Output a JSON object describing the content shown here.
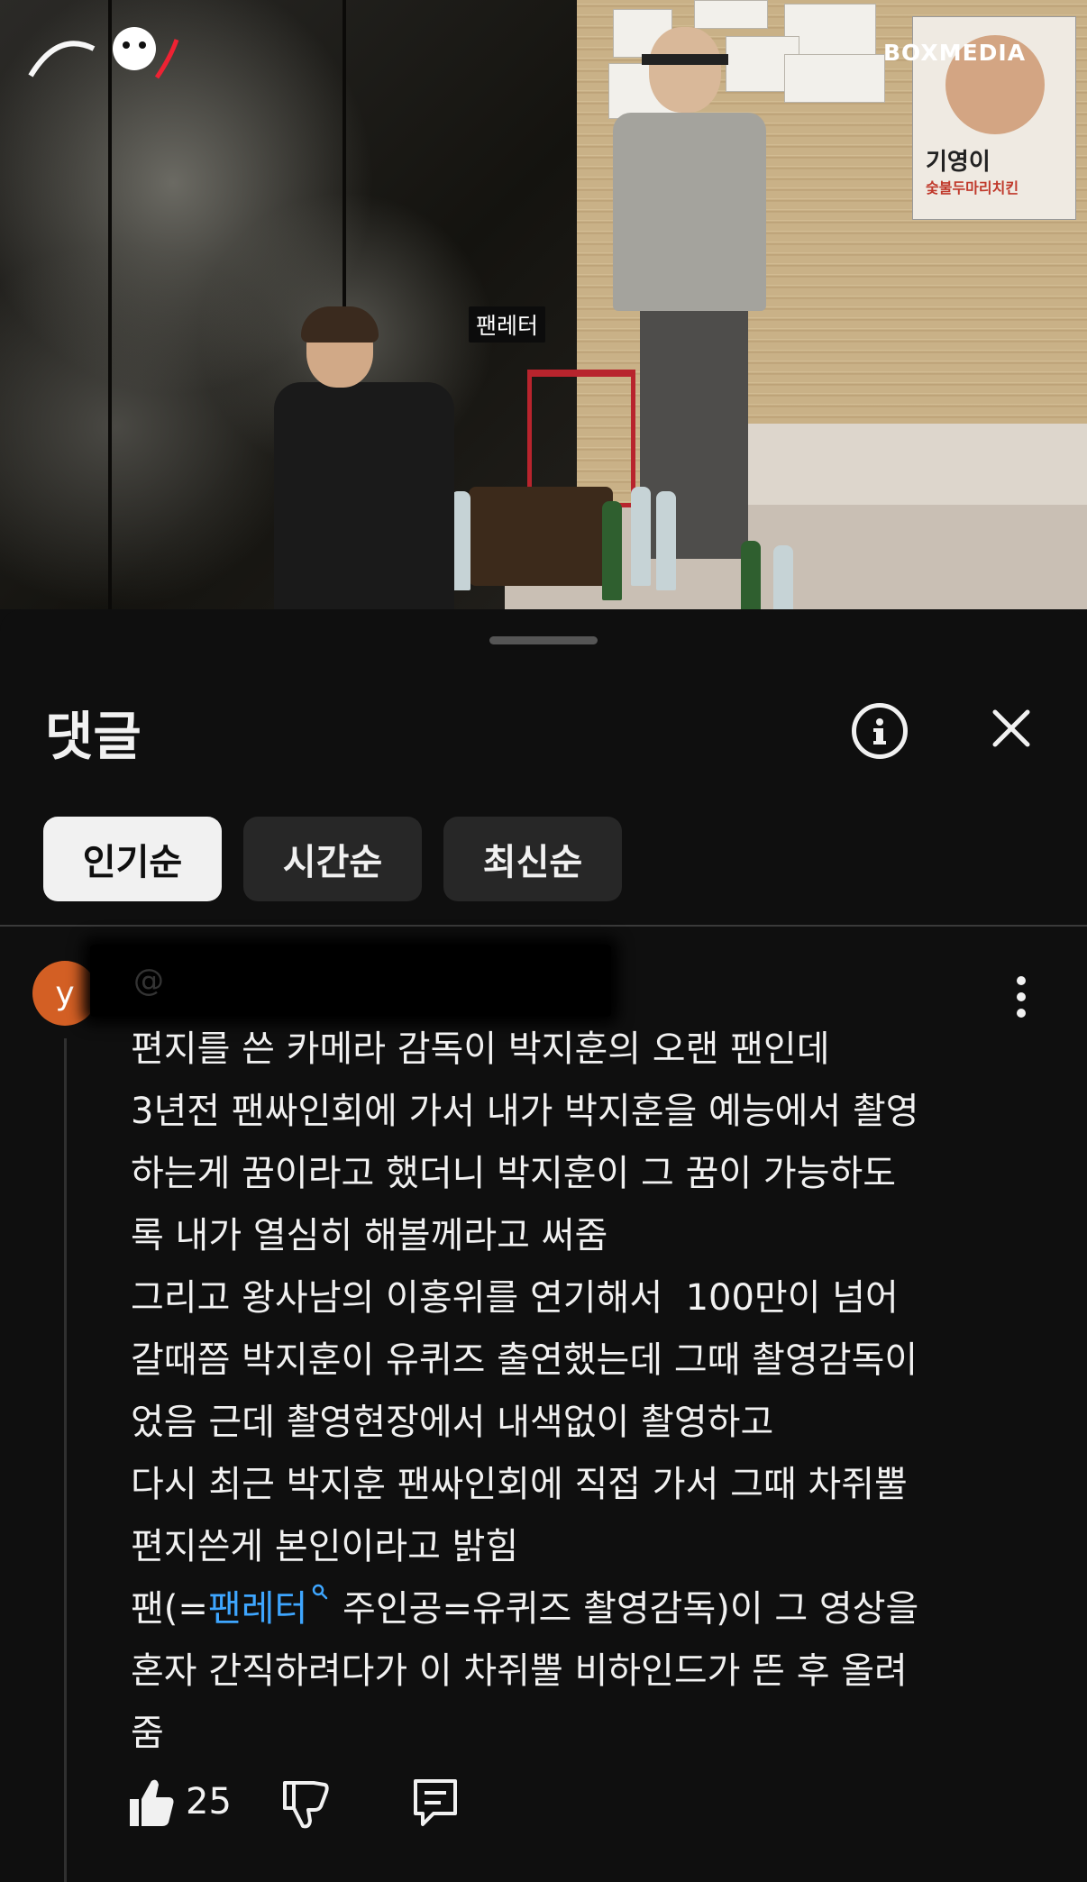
{
  "video": {
    "channel_logo": "BOXMEDIA",
    "caption_tag": "팬레터",
    "poster_title": "기영이",
    "poster_subtitle": "숯불두마리치킨"
  },
  "sheet": {
    "title": "댓글",
    "icons": {
      "info": "info-icon",
      "close": "close-icon"
    }
  },
  "sort_chips": [
    {
      "label": "인기순",
      "active": true
    },
    {
      "label": "시간순",
      "active": false
    },
    {
      "label": "최신순",
      "active": false
    }
  ],
  "comment": {
    "avatar_letter": "y",
    "author_prefix": "@",
    "text_before_link": "편지를 쓴 카메라 감독이 박지훈의 오랜 팬인데\n3년전 팬싸인회에 가서 내가 박지훈을 예능에서 촬영\n하는게 꿈이라고 했더니 박지훈이 그 꿈이 가능하도\n록 내가 열심히 해볼께라고 써줌\n그리고 왕사남의 이홍위를 연기해서  100만이 넘어\n갈때쯤 박지훈이 유퀴즈 출연했는데 그때 촬영감독이\n었음 근데 촬영현장에서 내색없이 촬영하고\n다시 최근 박지훈 팬싸인회에 직접 가서 그때 차쥐뿔\n편지쓴게 본인이라고 밝힘\n팬(=",
    "link_text": "팬레터",
    "text_after_link": " 주인공=유퀴즈 촬영감독)이 그 영상을\n혼자 간직하려다가 이 차쥐뿔 비하인드가 뜬 후 올려\n줌",
    "like_count": "25",
    "colors": {
      "link": "#3ea6ff",
      "avatar": "#d35f24"
    }
  }
}
